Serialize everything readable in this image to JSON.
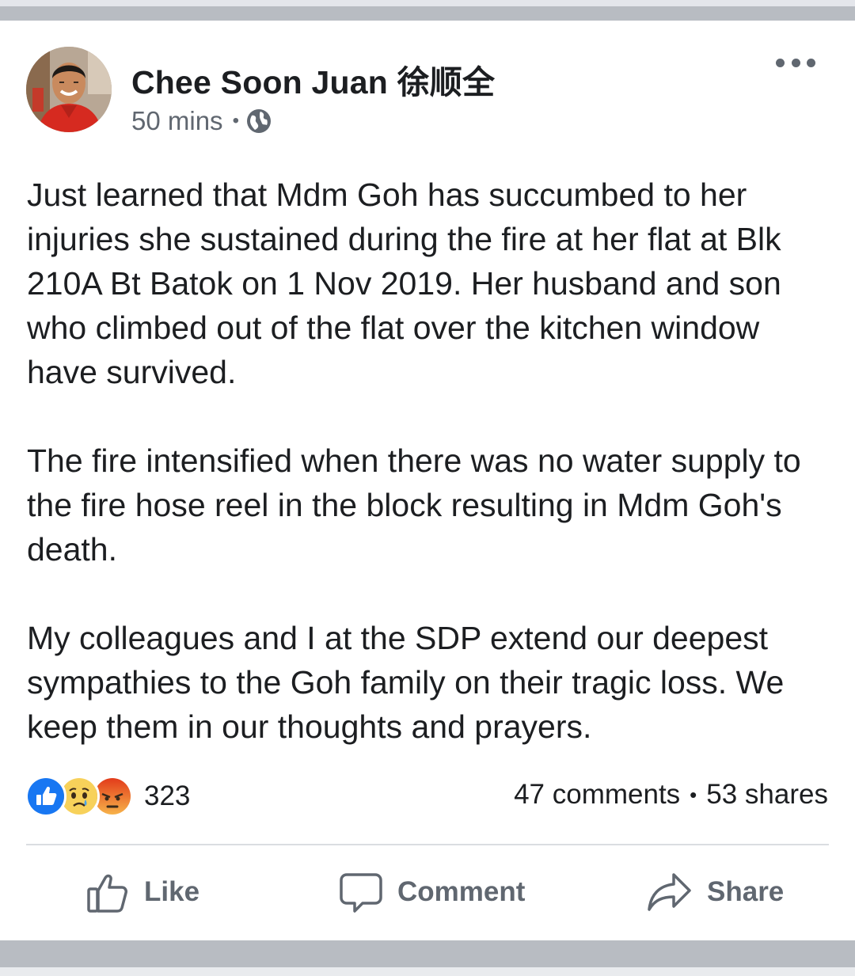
{
  "post": {
    "author": "Chee Soon Juan 徐顺全",
    "timestamp": "50 mins",
    "separator": "•",
    "privacy_icon": "globe-icon",
    "more_icon": "more-options-icon",
    "paragraphs": [
      "Just learned that Mdm Goh has succumbed to her injuries she sustained during the fire at her flat at Blk 210A Bt Batok on 1 Nov 2019. Her husband and son who climbed out of the flat over the kitchen window have survived.",
      "The fire intensified when there was no water supply to the fire hose reel in the block resulting in Mdm Goh's death.",
      "My colleagues and I at the SDP extend our deepest sympathies to the Goh family on their tragic loss. We keep them in our thoughts and prayers."
    ]
  },
  "engagement": {
    "reaction_icons": [
      "like-reaction-icon",
      "sad-reaction-icon",
      "angry-reaction-icon"
    ],
    "reaction_count": "323",
    "comments": "47 comments",
    "separator": "•",
    "shares": "53 shares"
  },
  "actions": {
    "like": "Like",
    "comment": "Comment",
    "share": "Share"
  },
  "colors": {
    "like_blue": "#1877f2",
    "angry_orange": "#e9710f",
    "sad_yellow": "#f7d15a",
    "text": "#1c1e21",
    "muted": "#606770",
    "strip": "#b8bcc2"
  }
}
